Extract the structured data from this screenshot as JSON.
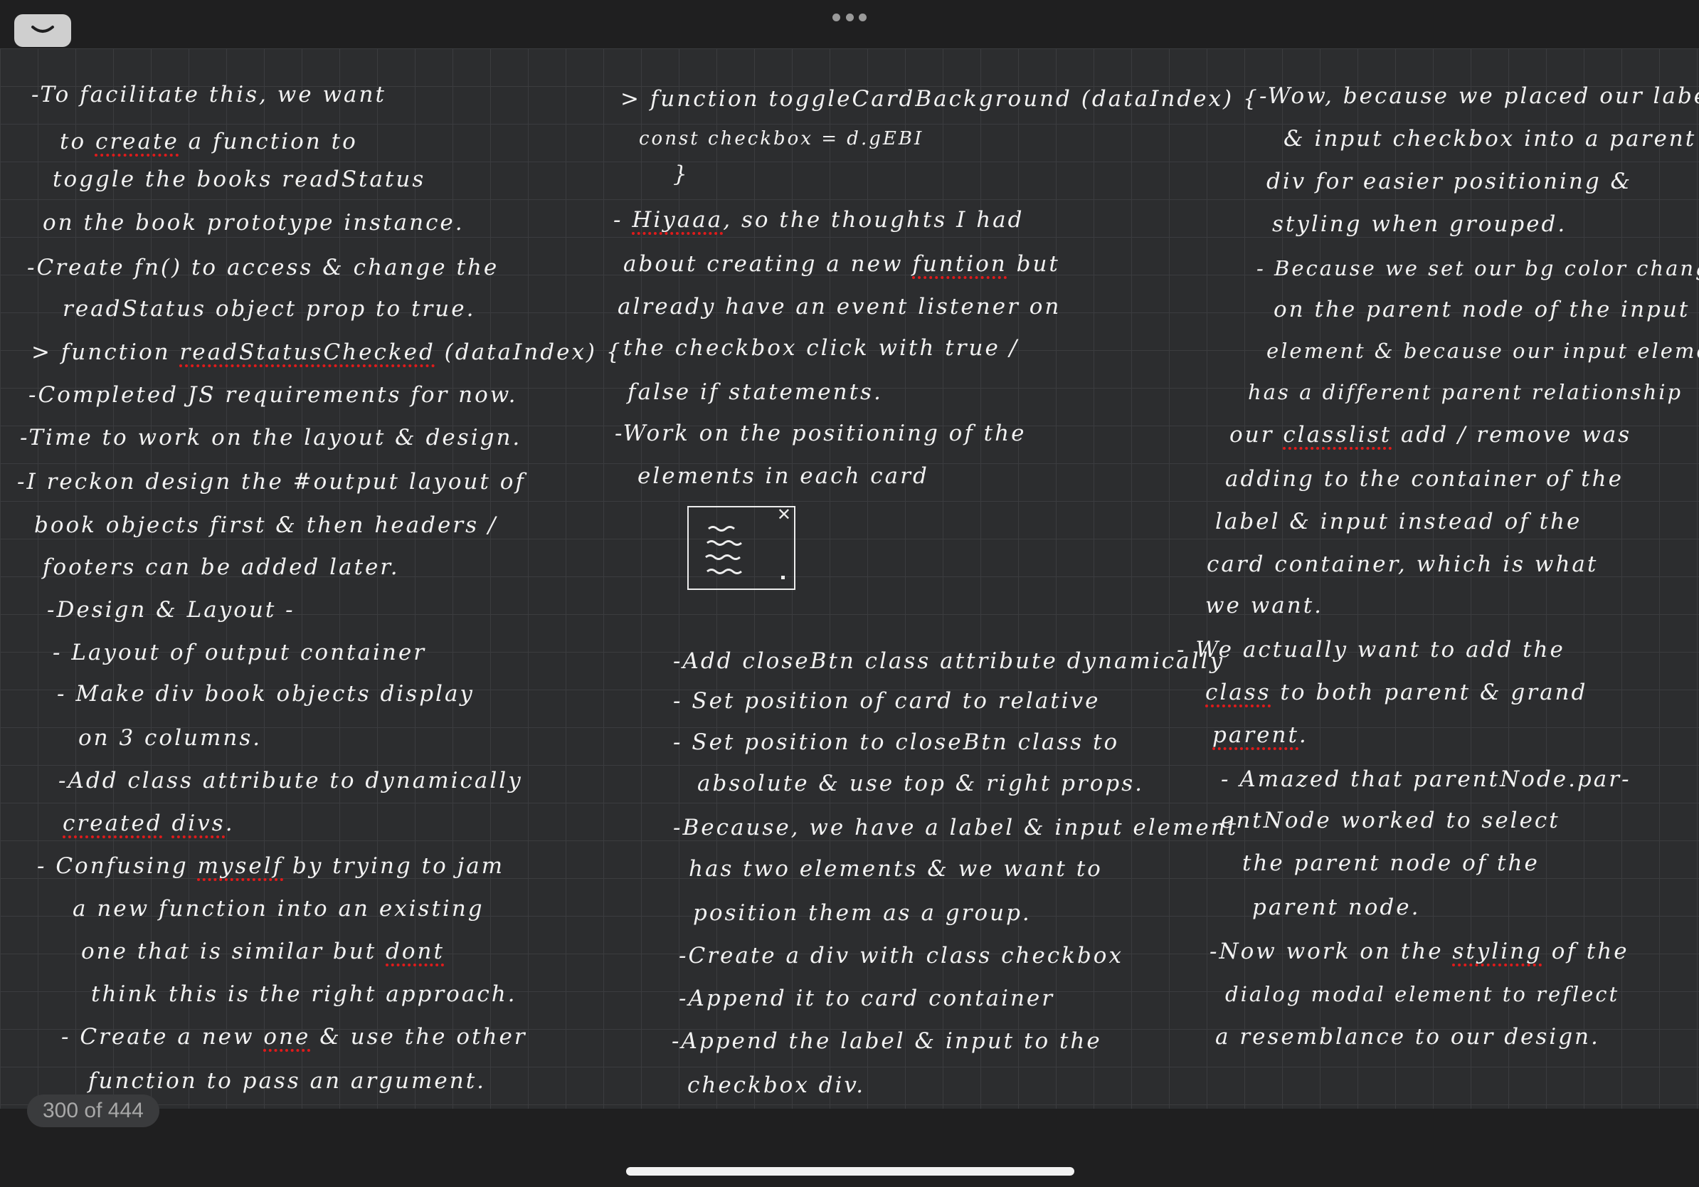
{
  "toolbar": {
    "collapse_icon": "chevron-down-icon",
    "more_icon": "ellipsis-icon"
  },
  "footer": {
    "page_counter": "300 of 444"
  },
  "notes": {
    "left": [
      "-To facilitate this, we want",
      "to create a function to",
      "toggle the books readStatus",
      "on the book prototype instance.",
      "-Create fn() to access & change the",
      "readStatus object prop to true.",
      "> function readStatusChecked (dataIndex) {",
      "-Completed JS requirements for now.",
      "-Time to work on the layout & design.",
      "-I reckon design the #output layout of",
      "book objects first & then headers /",
      "footers can be added later.",
      "-Design & Layout -",
      "- Layout of output container",
      "- Make div book objects display",
      "on 3 columns.",
      "-Add class attribute to dynamically",
      "created divs.",
      "- Confusing myself by trying to jam",
      "a new function into an existing",
      "one that is similar but dont",
      "think this is the right approach.",
      "- Create a new one & use the other",
      "function to pass an argument."
    ],
    "middle": [
      "> function toggleCardBackground (dataIndex) {",
      "const checkbox = d.gEBI",
      "}",
      "- Hiyaaa, so the thoughts I had",
      "about creating a new funtion but",
      "already have an event listener on",
      "the checkbox click with true /",
      "false if statements.",
      "-Work on the positioning of the",
      "elements in each card",
      "-Add closeBtn class attribute dynamically",
      "- Set position of card to relative",
      "- Set position to closeBtn class to",
      "absolute & use top & right props.",
      "-Because, we have a label & input element",
      "has two elements & we want to",
      "position them as a group.",
      "-Create a div with class checkbox",
      "-Append it to card container",
      "-Append the label & input to the",
      "checkbox div."
    ],
    "right": [
      "-Wow, because we placed our label",
      "& input checkbox into a parent",
      "div for easier positioning &",
      "styling when grouped.",
      "- Because we set our bg color change",
      "on the parent node of the input",
      "element & because our input element",
      "has a different parent relationship",
      "our classlist add / remove was",
      "adding to the container of the",
      "label & input instead of the",
      "card container, which is what",
      "we want.",
      "- We actually want to add the",
      "class to both parent & grand",
      "parent.",
      "- Amazed that parentNode.par-",
      "entNode worked to select",
      "the parent node of the",
      "parent node.",
      "-Now work on the styling of the",
      "dialog modal element to reflect",
      "a resemblance to our design."
    ]
  },
  "sketch": {
    "icon": "card-sketch-icon",
    "close_mark": "✕"
  }
}
